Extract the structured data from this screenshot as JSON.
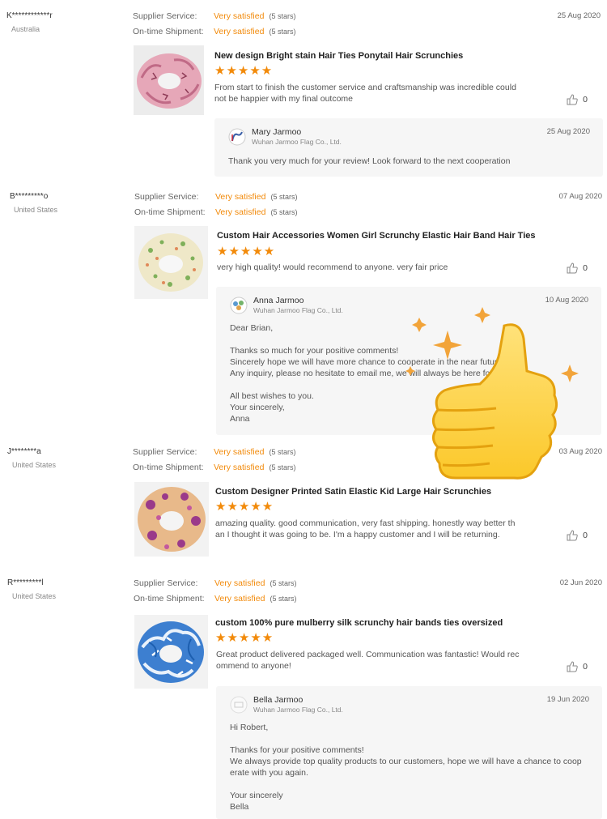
{
  "labels": {
    "supplier_service": "Supplier Service:",
    "ontime_shipment": "On-time Shipment:"
  },
  "colors": {
    "accent": "#f28a0a",
    "reply_bg": "#f6f6f6"
  },
  "reviews": [
    {
      "reviewer": "K************r",
      "country": "Australia",
      "supplier_rating": "Very satisfied",
      "supplier_stars": "(5 stars)",
      "shipment_rating": "Very satisfied",
      "shipment_stars": "(5 stars)",
      "date": "25 Aug 2020",
      "product_title": "New design Bright stain Hair Ties Ponytail Hair Scrunchies",
      "stars": "★★★★★",
      "rating_value": 5,
      "text_lines": [
        "From start to finish the customer service and craftsmanship was incredible could",
        "not be happier with my final outcome"
      ],
      "likes": "0",
      "reply": {
        "name": "Mary Jarmoo",
        "company": "Wuhan Jarmoo Flag Co., Ltd.",
        "date": "25 Aug 2020",
        "lines": [
          "Thank you very much for your review! Look forward to the next cooperation"
        ]
      }
    },
    {
      "reviewer": "B*********o",
      "country": "United States",
      "supplier_rating": "Very satisfied",
      "supplier_stars": "(5 stars)",
      "shipment_rating": "Very satisfied",
      "shipment_stars": "(5 stars)",
      "date": "07 Aug 2020",
      "product_title": "Custom Hair Accessories Women Girl Scrunchy Elastic Hair Band Hair Ties",
      "stars": "★★★★★",
      "rating_value": 5,
      "text_lines": [
        "very high quality! would recommend to anyone. very fair price"
      ],
      "likes": "0",
      "reply": {
        "name": "Anna Jarmoo",
        "company": "Wuhan Jarmoo Flag Co., Ltd.",
        "date": "10 Aug 2020",
        "lines": [
          "Dear Brian,",
          "",
          "Thanks so much for your positive comments!",
          "Sincerely hope we will have more chance to cooperate in the near future.",
          "Any inquiry, please no hesitate to email me, we will always be here for you !",
          "",
          "All best wishes to you.",
          "Your sincerely,",
          "Anna"
        ]
      }
    },
    {
      "reviewer": "J********a",
      "country": "United States",
      "supplier_rating": "Very satisfied",
      "supplier_stars": "(5 stars)",
      "shipment_rating": "Very satisfied",
      "shipment_stars": "(5 stars)",
      "date": "03 Aug 2020",
      "product_title": "Custom Designer Printed Satin Elastic Kid Large Hair Scrunchies",
      "stars": "★★★★★",
      "rating_value": 5,
      "text_lines": [
        "amazing quality. good communication, very fast shipping.  honestly way better th",
        "an I thought it was going to be. I'm a happy customer and I will be returning."
      ],
      "likes": "0"
    },
    {
      "reviewer": "R*********l",
      "country": "United States",
      "supplier_rating": "Very satisfied",
      "supplier_stars": "(5 stars)",
      "shipment_rating": "Very satisfied",
      "shipment_stars": "(5 stars)",
      "date": "02 Jun 2020",
      "product_title": "custom 100% pure mulberry silk scrunchy hair bands ties oversized",
      "stars": "★★★★★",
      "rating_value": 5,
      "text_lines": [
        "Great product delivered packaged well.  Communication was fantastic!  Would rec",
        "ommend to anyone!"
      ],
      "likes": "0",
      "reply": {
        "name": "Bella Jarmoo",
        "company": "Wuhan Jarmoo Flag Co., Ltd.",
        "date": "19 Jun 2020",
        "lines": [
          "Hi Robert,",
          "",
          "Thanks for your positive comments!",
          "We always provide top quality products to our customers, hope we will have a chance to coop",
          "erate with you again.",
          "",
          "Your sincerely",
          "Bella"
        ]
      }
    }
  ]
}
